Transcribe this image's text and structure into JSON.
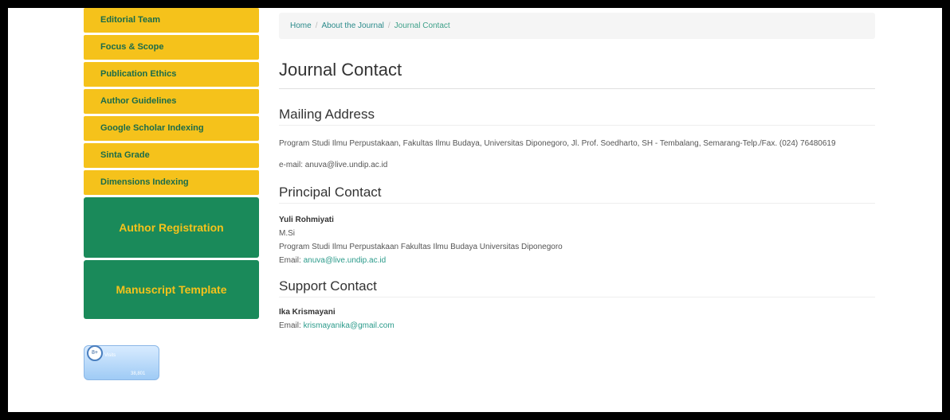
{
  "sidebar": {
    "menu_items": [
      {
        "label": "Editorial Team"
      },
      {
        "label": "Focus & Scope"
      },
      {
        "label": "Publication Ethics"
      },
      {
        "label": "Author Guidelines"
      },
      {
        "label": "Google Scholar Indexing"
      },
      {
        "label": "Sinta Grade"
      },
      {
        "label": "Dimensions Indexing"
      }
    ],
    "author_registration": "Author Registration",
    "manuscript_template": "Manuscript Template",
    "visitor_badge": {
      "line1": "Visits",
      "line2": "38,801",
      "icon_text": "8+"
    }
  },
  "breadcrumb": {
    "home": "Home",
    "about": "About the Journal",
    "current": "Journal Contact",
    "separator": "/"
  },
  "page_title": "Journal Contact",
  "mailing": {
    "heading": "Mailing Address",
    "address": "Program Studi Ilmu Perpustakaan, Fakultas Ilmu Budaya, Universitas Diponegoro, Jl. Prof. Soedharto, SH - Tembalang, Semarang-Telp./Fax. (024) 76480619",
    "email_line": "e-mail: anuva@live.undip.ac.id"
  },
  "principal": {
    "heading": "Principal Contact",
    "name": "Yuli Rohmiyati",
    "title": "M.Si",
    "affiliation": "Program Studi Ilmu Perpustakaan Fakultas Ilmu Budaya Universitas Diponegoro",
    "email_label": "Email:",
    "email": "anuva@live.undip.ac.id"
  },
  "support": {
    "heading": "Support Contact",
    "name": "Ika Krismayani",
    "email_label": "Email:",
    "email": "krismayanika@gmail.com"
  },
  "colors": {
    "menu_bg": "#f5c21b",
    "menu_text": "#1a6b4a",
    "green_button": "#1a8a5a",
    "link": "#2a9a8a"
  }
}
